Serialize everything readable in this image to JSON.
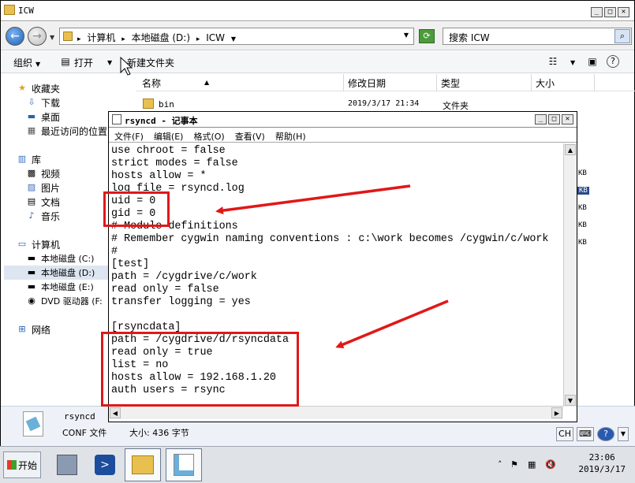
{
  "explorer": {
    "title": "ICW",
    "breadcrumbs": [
      "计算机",
      "本地磁盘 (D:)",
      "ICW"
    ],
    "search_placeholder": "搜索 ICW",
    "toolbar": {
      "organize": "组织",
      "open": "打开",
      "new_folder": "新建文件夹"
    },
    "nav": {
      "favorites": "收藏夹",
      "downloads": "下载",
      "desktop": "桌面",
      "recent": "最近访问的位置",
      "libraries": "库",
      "videos": "视频",
      "pictures": "图片",
      "documents": "文档",
      "music": "音乐",
      "computer": "计算机",
      "disk_c": "本地磁盘 (C:)",
      "disk_d": "本地磁盘 (D:)",
      "disk_e": "本地磁盘 (E:)",
      "dvd": "DVD 驱动器 (F:",
      "network": "网络"
    },
    "columns": {
      "name": "名称",
      "modified": "修改日期",
      "type": "类型",
      "size": "大小"
    },
    "files": [
      {
        "name": "bin",
        "modified": "2019/3/17 21:34",
        "type": "文件夹"
      }
    ],
    "size_fragments": [
      "KB",
      "KB",
      "KB",
      "KB",
      "KB"
    ],
    "details": {
      "name": "rsyncd",
      "type": "CONF 文件",
      "size": "大小: 436 字节"
    }
  },
  "notepad": {
    "title": "rsyncd - 记事本",
    "menu": [
      "文件(F)",
      "编辑(E)",
      "格式(O)",
      "查看(V)",
      "帮助(H)"
    ],
    "lines": [
      "use chroot = false",
      "strict modes = false",
      "hosts allow = *",
      "log file = rsyncd.log",
      "uid = 0",
      "gid = 0",
      "# Module definitions",
      "# Remember cygwin naming conventions : c:\\work becomes /cygwin/c/work",
      "#",
      "[test]",
      "path = /cygdrive/c/work",
      "read only = false",
      "transfer logging = yes",
      "",
      "[rsyncdata]",
      "path = /cygdrive/d/rsyncdata",
      "read only = true",
      "list = no",
      "hosts allow = 192.168.1.20",
      "auth users = rsync"
    ]
  },
  "statusbar": {
    "ime": "CH"
  },
  "taskbar": {
    "start": "开始",
    "time": "23:06",
    "date": "2019/3/17"
  },
  "colors": {
    "annotation": "#e01818",
    "selection": "#2a4a8a"
  }
}
